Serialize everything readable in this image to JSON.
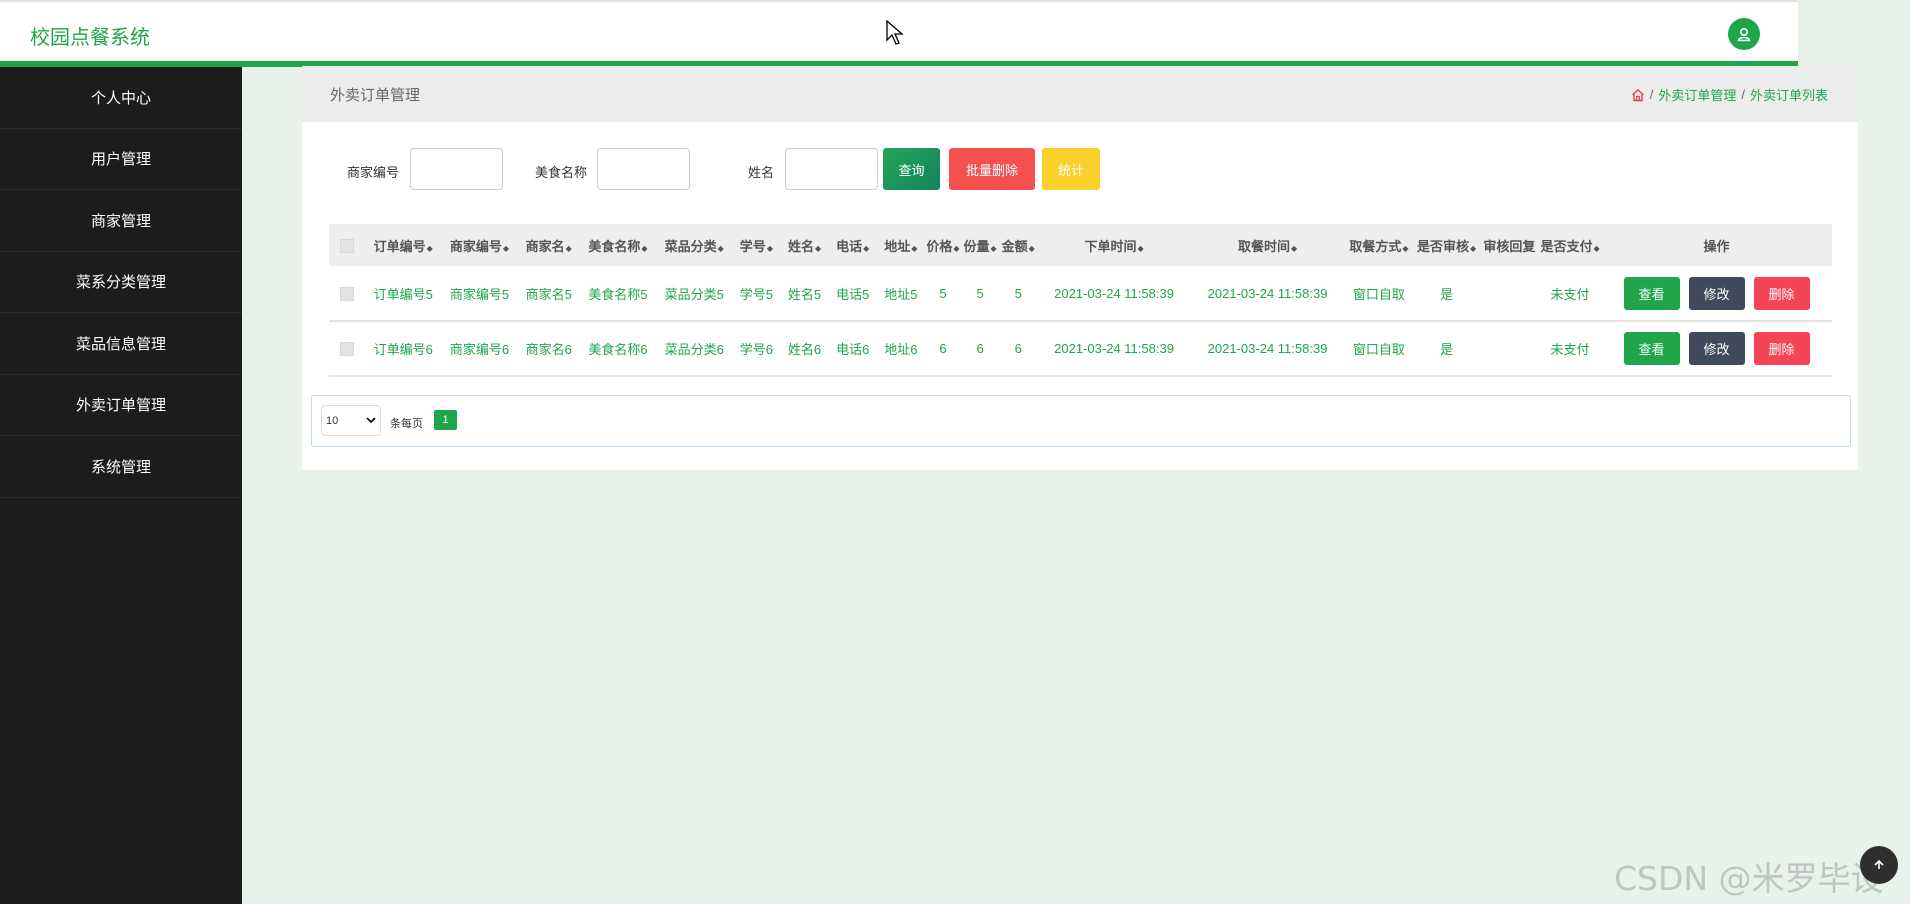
{
  "header": {
    "title": "校园点餐系统",
    "avatar_icon": "user-icon",
    "accent_color": "#1fa54a"
  },
  "sidebar": {
    "items": [
      {
        "label": "个人中心"
      },
      {
        "label": "用户管理"
      },
      {
        "label": "商家管理"
      },
      {
        "label": "菜系分类管理"
      },
      {
        "label": "菜品信息管理"
      },
      {
        "label": "外卖订单管理"
      },
      {
        "label": "系统管理"
      }
    ]
  },
  "breadcrumb": {
    "title": "外卖订单管理",
    "home_icon": "home-icon",
    "items": [
      "外卖订单管理",
      "外卖订单列表"
    ],
    "separator": "/"
  },
  "search": {
    "merchant_no_label": "商家编号",
    "food_name_label": "美食名称",
    "name_label": "姓名",
    "query_btn": "查询",
    "batch_delete_btn": "批量删除",
    "stats_btn": "统计"
  },
  "table": {
    "columns": [
      "订单编号",
      "商家编号",
      "商家名",
      "美食名称",
      "菜品分类",
      "学号",
      "姓名",
      "电话",
      "地址",
      "价格",
      "份量",
      "金额",
      "下单时间",
      "取餐时间",
      "取餐方式",
      "是否审核",
      "审核回复",
      "是否支付",
      "操作"
    ],
    "rows": [
      {
        "order_no": "订单编号5",
        "merchant_no": "商家编号5",
        "merchant_name": "商家名5",
        "food_name": "美食名称5",
        "category": "菜品分类5",
        "student_no": "学号5",
        "name": "姓名5",
        "phone": "电话5",
        "address": "地址5",
        "price": "5",
        "portion": "5",
        "amount": "5",
        "order_time": "2021-03-24 11:58:39",
        "pickup_time": "2021-03-24 11:58:39",
        "pickup_method": "窗口自取",
        "reviewed": "是",
        "review_reply": "",
        "paid": "未支付"
      },
      {
        "order_no": "订单编号6",
        "merchant_no": "商家编号6",
        "merchant_name": "商家名6",
        "food_name": "美食名称6",
        "category": "菜品分类6",
        "student_no": "学号6",
        "name": "姓名6",
        "phone": "电话6",
        "address": "地址6",
        "price": "6",
        "portion": "6",
        "amount": "6",
        "order_time": "2021-03-24 11:58:39",
        "pickup_time": "2021-03-24 11:58:39",
        "pickup_method": "窗口自取",
        "reviewed": "是",
        "review_reply": "",
        "paid": "未支付"
      }
    ],
    "actions": {
      "view": "查看",
      "edit": "修改",
      "delete": "删除"
    }
  },
  "pagination": {
    "page_size": "10",
    "per_page_label": "条每页",
    "current_page": "1"
  },
  "watermark": "CSDN @米罗毕设"
}
